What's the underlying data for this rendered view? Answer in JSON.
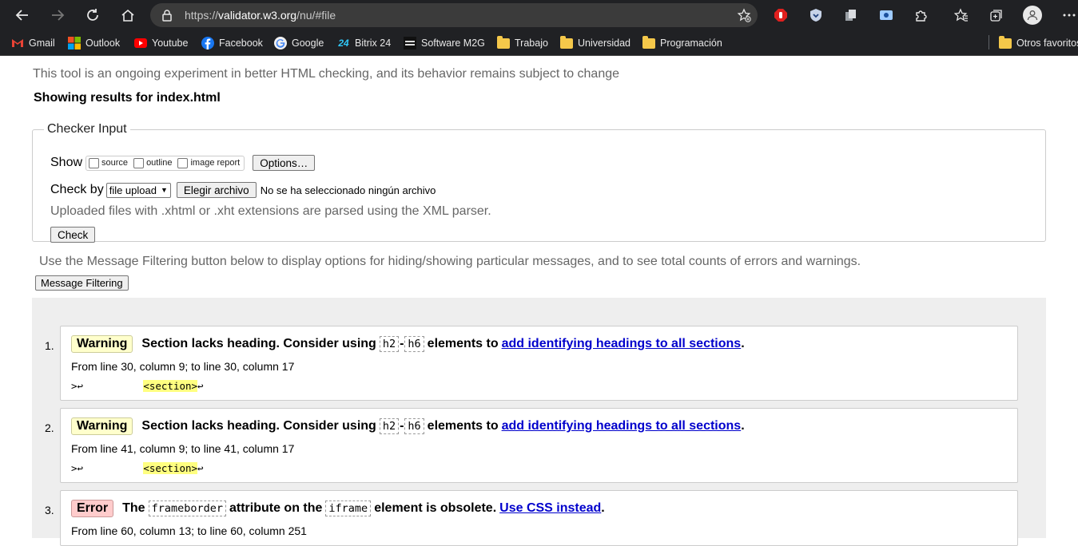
{
  "browser": {
    "url_prefix": "https://",
    "url_host": "validator.w3.org",
    "url_path": "/nu/#file",
    "bookmarks": [
      {
        "label": "Gmail",
        "icon": "gmail-icon"
      },
      {
        "label": "Outlook",
        "icon": "outlook-icon"
      },
      {
        "label": "Youtube",
        "icon": "youtube-icon"
      },
      {
        "label": "Facebook",
        "icon": "facebook-icon"
      },
      {
        "label": "Google",
        "icon": "google-icon"
      },
      {
        "label": "Bitrix 24",
        "icon": "bitrix-icon"
      },
      {
        "label": "Software M2G",
        "icon": "m2g-icon"
      },
      {
        "label": "Trabajo",
        "icon": "folder-icon"
      },
      {
        "label": "Universidad",
        "icon": "folder-icon"
      },
      {
        "label": "Programación",
        "icon": "folder-icon"
      }
    ],
    "other_bookmarks": "Otros favoritos"
  },
  "page": {
    "subtitle": "This tool is an ongoing experiment in better HTML checking, and its behavior remains subject to change",
    "results_for": "Showing results for index.html"
  },
  "checker": {
    "legend": "Checker Input",
    "show_label": "Show",
    "show_options": [
      "source",
      "outline",
      "image report"
    ],
    "options_button": "Options…",
    "check_by_label": "Check by",
    "check_by_value": "file upload",
    "choose_file_button": "Elegir archivo",
    "no_file_text": "No se ha seleccionado ningún archivo",
    "xml_note": "Uploaded files with .xhtml or .xht extensions are parsed using the XML parser.",
    "check_button": "Check"
  },
  "filter": {
    "note": "Use the Message Filtering button below to display options for hiding/showing particular messages, and to see total counts of errors and warnings.",
    "button": "Message Filtering"
  },
  "messages": [
    {
      "num": "1.",
      "type": "Warning",
      "text_a": "Section lacks heading. Consider using",
      "code_a": "h2",
      "dash": "-",
      "code_b": "h6",
      "text_b": "elements to",
      "link": "add identifying headings to all sections",
      "end": ".",
      "location": "From line 30, column 9; to line 30, column 17",
      "extract_pre": ">↩          ",
      "extract_hl": "<section>",
      "extract_post": "↩"
    },
    {
      "num": "2.",
      "type": "Warning",
      "text_a": "Section lacks heading. Consider using",
      "code_a": "h2",
      "dash": "-",
      "code_b": "h6",
      "text_b": "elements to",
      "link": "add identifying headings to all sections",
      "end": ".",
      "location": "From line 41, column 9; to line 41, column 17",
      "extract_pre": ">↩          ",
      "extract_hl": "<section>",
      "extract_post": "↩"
    },
    {
      "num": "3.",
      "type": "Error",
      "text_a": "The",
      "code_a": "frameborder",
      "text_b": "attribute on the",
      "code_b": "iframe",
      "text_c": "element is obsolete.",
      "link": "Use CSS instead",
      "end": ".",
      "location": "From line 60, column 13; to line 60, column 251"
    }
  ],
  "colors": {
    "chrome": "#202124",
    "address_bar": "#3b3b3b",
    "warning_badge": "#ffffcc",
    "error_badge": "#ffcccc",
    "link": "#0000cc",
    "highlight": "#ffff80"
  }
}
